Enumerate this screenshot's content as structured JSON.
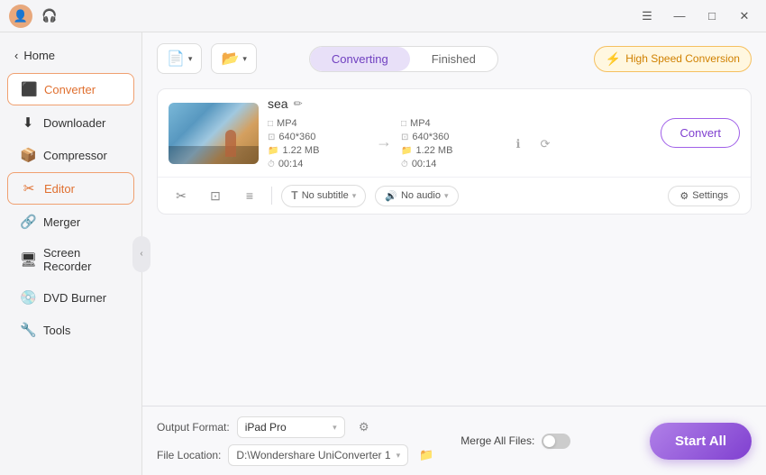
{
  "titlebar": {
    "avatar_icon": "👤",
    "headphone_icon": "🎧",
    "minimize_label": "—",
    "maximize_label": "□",
    "close_label": "✕",
    "menu_icon": "☰"
  },
  "sidebar": {
    "home_label": "Home",
    "back_icon": "‹",
    "items": [
      {
        "id": "converter",
        "label": "Converter",
        "icon": "⬛",
        "active": true
      },
      {
        "id": "downloader",
        "label": "Downloader",
        "icon": "⬇",
        "active": false
      },
      {
        "id": "compressor",
        "label": "Compressor",
        "icon": "📦",
        "active": false
      },
      {
        "id": "editor",
        "label": "Editor",
        "icon": "✂",
        "active": false,
        "highlighted": true
      },
      {
        "id": "merger",
        "label": "Merger",
        "icon": "🔗",
        "active": false
      },
      {
        "id": "screen-recorder",
        "label": "Screen Recorder",
        "icon": "🖥",
        "active": false
      },
      {
        "id": "dvd-burner",
        "label": "DVD Burner",
        "icon": "💿",
        "active": false
      },
      {
        "id": "tools",
        "label": "Tools",
        "icon": "🔧",
        "active": false
      }
    ]
  },
  "toolbar": {
    "add_file_icon": "📄",
    "add_file_label": "▾",
    "add_folder_icon": "📂",
    "add_folder_label": "▾"
  },
  "tabs": {
    "converting_label": "Converting",
    "finished_label": "Finished",
    "active": "converting"
  },
  "high_speed": {
    "label": "High Speed Conversion",
    "icon": "⚡"
  },
  "file_item": {
    "name": "sea",
    "edit_icon": "✏",
    "source": {
      "format": "MP4",
      "resolution": "640*360",
      "size": "1.22 MB",
      "duration": "00:14"
    },
    "dest": {
      "format": "MP4",
      "resolution": "640*360",
      "size": "1.22 MB",
      "duration": "00:14"
    },
    "convert_btn_label": "Convert",
    "subtitle_label": "No subtitle",
    "audio_label": "No audio",
    "settings_label": "Settings",
    "cut_icon": "✂",
    "crop_icon": "⊡",
    "effects_icon": "≡"
  },
  "bottom_bar": {
    "output_format_label": "Output Format:",
    "output_format_value": "iPad Pro",
    "file_location_label": "File Location:",
    "file_location_value": "D:\\Wondershare UniConverter 1",
    "merge_files_label": "Merge All Files:",
    "start_all_label": "Start All",
    "settings_icon": "⚙",
    "folder_icon": "📁"
  }
}
